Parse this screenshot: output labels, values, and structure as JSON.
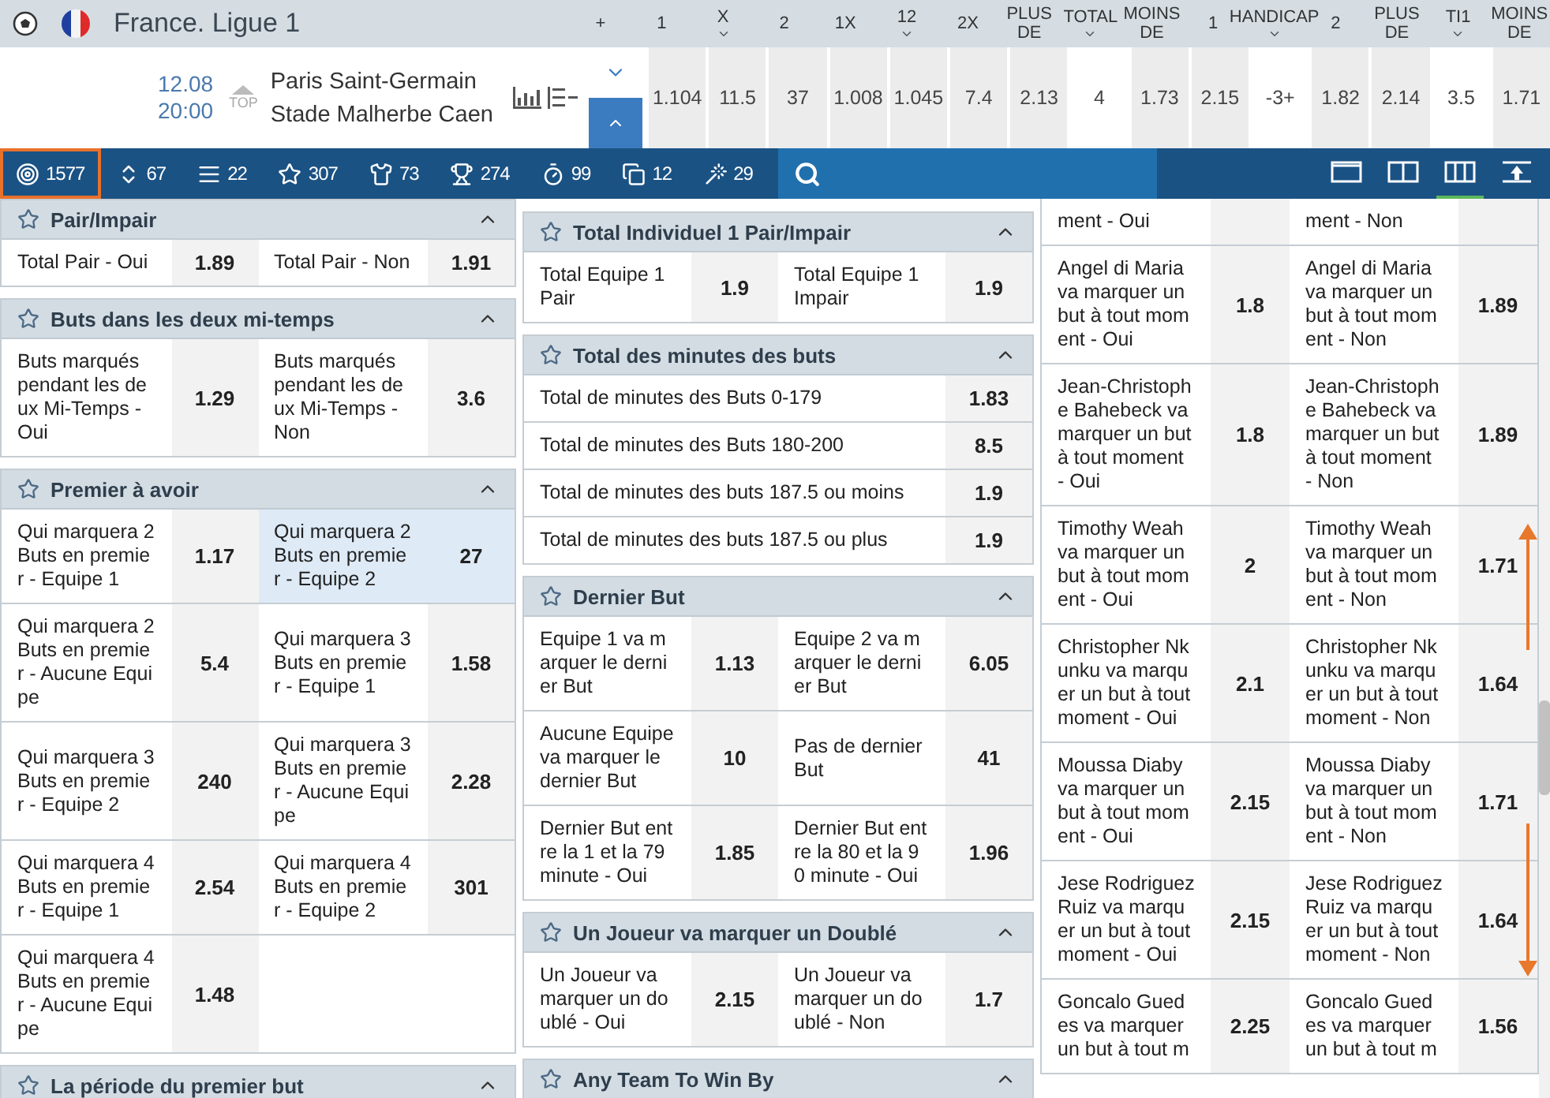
{
  "league": {
    "title": "France. Ligue 1"
  },
  "columns": [
    {
      "label": "+",
      "dropdown": false
    },
    {
      "label": "1",
      "dropdown": false
    },
    {
      "label": "X",
      "dropdown": true
    },
    {
      "label": "2",
      "dropdown": false
    },
    {
      "label": "1X",
      "dropdown": false
    },
    {
      "label": "12",
      "dropdown": true
    },
    {
      "label": "2X",
      "dropdown": false
    },
    {
      "label": "PLUS DE",
      "dropdown": false
    },
    {
      "label": "TOTAL",
      "dropdown": true
    },
    {
      "label": "MOINS DE",
      "dropdown": false
    },
    {
      "label": "1",
      "dropdown": false
    },
    {
      "label": "HANDICAP",
      "dropdown": true
    },
    {
      "label": "2",
      "dropdown": false
    },
    {
      "label": "PLUS DE",
      "dropdown": false
    },
    {
      "label": "TI1",
      "dropdown": true
    },
    {
      "label": "MOINS DE",
      "dropdown": false
    }
  ],
  "match": {
    "date": "12.08",
    "time": "20:00",
    "badge": "TOP",
    "team_1": "Paris Saint-Germain",
    "team_2": "Stade Malherbe Caen",
    "cells": [
      {
        "kind": "odd",
        "value": "1.104"
      },
      {
        "kind": "odd",
        "value": "11.5"
      },
      {
        "kind": "odd",
        "value": "37"
      },
      {
        "kind": "odd",
        "value": "1.008"
      },
      {
        "kind": "odd",
        "value": "1.045"
      },
      {
        "kind": "odd",
        "value": "7.4"
      },
      {
        "kind": "odd",
        "value": "2.13"
      },
      {
        "kind": "param",
        "value": "4"
      },
      {
        "kind": "odd",
        "value": "1.73"
      },
      {
        "kind": "odd",
        "value": "2.15"
      },
      {
        "kind": "param",
        "value": "-3+"
      },
      {
        "kind": "odd",
        "value": "1.82"
      },
      {
        "kind": "odd",
        "value": "2.14"
      },
      {
        "kind": "param",
        "value": "3.5"
      },
      {
        "kind": "odd",
        "value": "1.71"
      }
    ]
  },
  "filters": [
    {
      "kind": "target",
      "count": "1577",
      "selected": true
    },
    {
      "kind": "updown",
      "count": "67",
      "selected": false
    },
    {
      "kind": "bars",
      "count": "22",
      "selected": false
    },
    {
      "kind": "star",
      "count": "307",
      "selected": false
    },
    {
      "kind": "shirt",
      "count": "73",
      "selected": false
    },
    {
      "kind": "trophy",
      "count": "274",
      "selected": false
    },
    {
      "kind": "timer",
      "count": "99",
      "selected": false
    },
    {
      "kind": "cards",
      "count": "12",
      "selected": false
    },
    {
      "kind": "wand",
      "count": "29",
      "selected": false
    }
  ],
  "layouts": [
    {
      "kind": "single",
      "selected": false
    },
    {
      "kind": "double",
      "selected": false
    },
    {
      "kind": "triple",
      "selected": true
    },
    {
      "kind": "top",
      "selected": false
    }
  ],
  "panels": [
    {
      "sections": [
        {
          "title": "Pair/Impair",
          "expanded": true,
          "kind": "pairs",
          "rows": [
            {
              "cells": [
                {
                  "label": "Total Pair - Oui",
                  "odd": "1.89",
                  "selected": false
                },
                {
                  "label": "Total Pair - Non",
                  "odd": "1.91",
                  "selected": false
                }
              ]
            }
          ]
        },
        {
          "title": "Buts dans les deux mi-temps",
          "expanded": true,
          "kind": "pairs",
          "rows": [
            {
              "cells": [
                {
                  "label": "Buts marqués pendant les deux Mi-Temps - Oui",
                  "odd": "1.29",
                  "selected": false
                },
                {
                  "label": "Buts marqués pendant les deux Mi-Temps - Non",
                  "odd": "3.6",
                  "selected": false
                }
              ]
            }
          ]
        },
        {
          "title": "Premier à avoir",
          "expanded": true,
          "kind": "pairs",
          "rows": [
            {
              "cells": [
                {
                  "label": "Qui marquera 2 Buts en premier - Equipe 1",
                  "odd": "1.17",
                  "selected": false
                },
                {
                  "label": "Qui marquera 2 Buts en premier - Equipe 2",
                  "odd": "27",
                  "selected": true
                }
              ]
            },
            {
              "cells": [
                {
                  "label": "Qui marquera 2 Buts en premier - Aucune Equipe",
                  "odd": "5.4",
                  "selected": false
                },
                {
                  "label": "Qui marquera 3 Buts en premier - Equipe 1",
                  "odd": "1.58",
                  "selected": false
                }
              ]
            },
            {
              "cells": [
                {
                  "label": "Qui marquera 3 Buts en premier - Equipe 2",
                  "odd": "240",
                  "selected": false
                },
                {
                  "label": "Qui marquera 3 Buts en premier - Aucune Equipe",
                  "odd": "2.28",
                  "selected": false
                }
              ]
            },
            {
              "cells": [
                {
                  "label": "Qui marquera 4 Buts en premier - Equipe 1",
                  "odd": "2.54",
                  "selected": false
                },
                {
                  "label": "Qui marquera 4 Buts en premier - Equipe 2",
                  "odd": "301",
                  "selected": false
                }
              ]
            },
            {
              "cells": [
                {
                  "label": "Qui marquera 4 Buts en premier - Aucune Equipe",
                  "odd": "1.48",
                  "selected": false
                }
              ]
            }
          ]
        },
        {
          "title": "La période du premier but",
          "expanded": true,
          "kind": "pairs"
        }
      ]
    },
    {
      "sections": [
        {
          "title": "Total Individuel 1 Pair/Impair",
          "expanded": true,
          "kind": "pairs",
          "rows": [
            {
              "cells": [
                {
                  "label": "Total Equipe 1 Pair",
                  "odd": "1.9",
                  "selected": false
                },
                {
                  "label": "Total Equipe 1 Impair",
                  "odd": "1.9",
                  "selected": false
                }
              ]
            }
          ]
        },
        {
          "title": "Total des minutes des buts",
          "expanded": true,
          "kind": "list",
          "rows": [
            {
              "cells": [
                {
                  "label": "Total de minutes des Buts 0-179",
                  "odd": "1.83",
                  "selected": false
                }
              ]
            },
            {
              "cells": [
                {
                  "label": "Total de minutes des Buts 180-200",
                  "odd": "8.5",
                  "selected": false
                }
              ]
            },
            {
              "cells": [
                {
                  "label": "Total de minutes des buts 187.5 ou moins",
                  "odd": "1.9",
                  "selected": false
                }
              ]
            },
            {
              "cells": [
                {
                  "label": "Total de minutes des buts 187.5 ou plus",
                  "odd": "1.9",
                  "selected": false
                }
              ]
            }
          ]
        },
        {
          "title": "Dernier But",
          "expanded": true,
          "kind": "pairs",
          "rows": [
            {
              "cells": [
                {
                  "label": "Equipe 1 va marquer le dernier But",
                  "odd": "1.13",
                  "selected": false
                },
                {
                  "label": "Equipe 2 va marquer le dernier But",
                  "odd": "6.05",
                  "selected": false
                }
              ]
            },
            {
              "cells": [
                {
                  "label": "Aucune Equipe va marquer le dernier But",
                  "odd": "10",
                  "selected": false
                },
                {
                  "label": "Pas de dernier But",
                  "odd": "41",
                  "selected": false
                }
              ]
            },
            {
              "cells": [
                {
                  "label": "Dernier But entre la 1 et la 79 minute - Oui",
                  "odd": "1.85",
                  "selected": false
                },
                {
                  "label": "Dernier But entre la 80 et la 90 minute - Oui",
                  "odd": "1.96",
                  "selected": false
                }
              ]
            }
          ]
        },
        {
          "title": "Un Joueur va marquer un Doublé",
          "expanded": true,
          "kind": "pairs",
          "rows": [
            {
              "cells": [
                {
                  "label": "Un Joueur va marquer un doublé - Oui",
                  "odd": "2.15",
                  "selected": false
                },
                {
                  "label": "Un Joueur va marquer un doublé - Non",
                  "odd": "1.7",
                  "selected": false
                }
              ]
            }
          ]
        },
        {
          "title": "Any Team To Win By",
          "expanded": true,
          "kind": "pairs"
        }
      ]
    },
    {
      "sections": [
        {
          "kind": "pairs",
          "rows": [
            {
              "cells": [
                {
                  "label": "ment - Oui",
                  "selected": false
                },
                {
                  "label": "ment - Non",
                  "selected": false
                }
              ]
            },
            {
              "cells": [
                {
                  "label": "Angel di Maria va marquer un but à tout moment - Oui",
                  "odd": "1.8",
                  "selected": false
                },
                {
                  "label": "Angel di Maria va marquer un but à tout moment - Non",
                  "odd": "1.89",
                  "selected": false
                }
              ]
            },
            {
              "cells": [
                {
                  "label": "Jean-Christophe Bahebeck va marquer un but à tout moment - Oui",
                  "odd": "1.8",
                  "selected": false
                },
                {
                  "label": "Jean-Christophe Bahebeck va marquer un but à tout moment - Non",
                  "odd": "1.89",
                  "selected": false
                }
              ]
            },
            {
              "cells": [
                {
                  "label": "Timothy Weah va marquer un but à tout moment - Oui",
                  "odd": "2",
                  "selected": false
                },
                {
                  "label": "Timothy Weah va marquer un but à tout moment - Non",
                  "odd": "1.71",
                  "selected": false
                }
              ]
            },
            {
              "cells": [
                {
                  "label": "Christopher Nkunku va marquer un but à tout moment - Oui",
                  "odd": "2.1",
                  "selected": false
                },
                {
                  "label": "Christopher Nkunku va marquer un but à tout moment - Non",
                  "odd": "1.64",
                  "selected": false
                }
              ]
            },
            {
              "cells": [
                {
                  "label": "Moussa Diaby va marquer un but à tout moment - Oui",
                  "odd": "2.15",
                  "selected": false
                },
                {
                  "label": "Moussa Diaby va marquer un but à tout moment - Non",
                  "odd": "1.71",
                  "selected": false
                }
              ]
            },
            {
              "cells": [
                {
                  "label": "Jese Rodriguez Ruiz va marquer un but à tout moment - Oui",
                  "odd": "2.15",
                  "selected": false
                },
                {
                  "label": "Jese Rodriguez Ruiz va marquer un but à tout moment - Non",
                  "odd": "1.64",
                  "selected": false
                }
              ]
            },
            {
              "cells": [
                {
                  "label": "Goncalo Guedes va marquer un but à tout m",
                  "odd": "2.25",
                  "selected": false
                },
                {
                  "label": "Goncalo Guedes va marquer un but à tout m",
                  "odd": "1.56",
                  "selected": false
                }
              ]
            }
          ]
        }
      ]
    }
  ]
}
